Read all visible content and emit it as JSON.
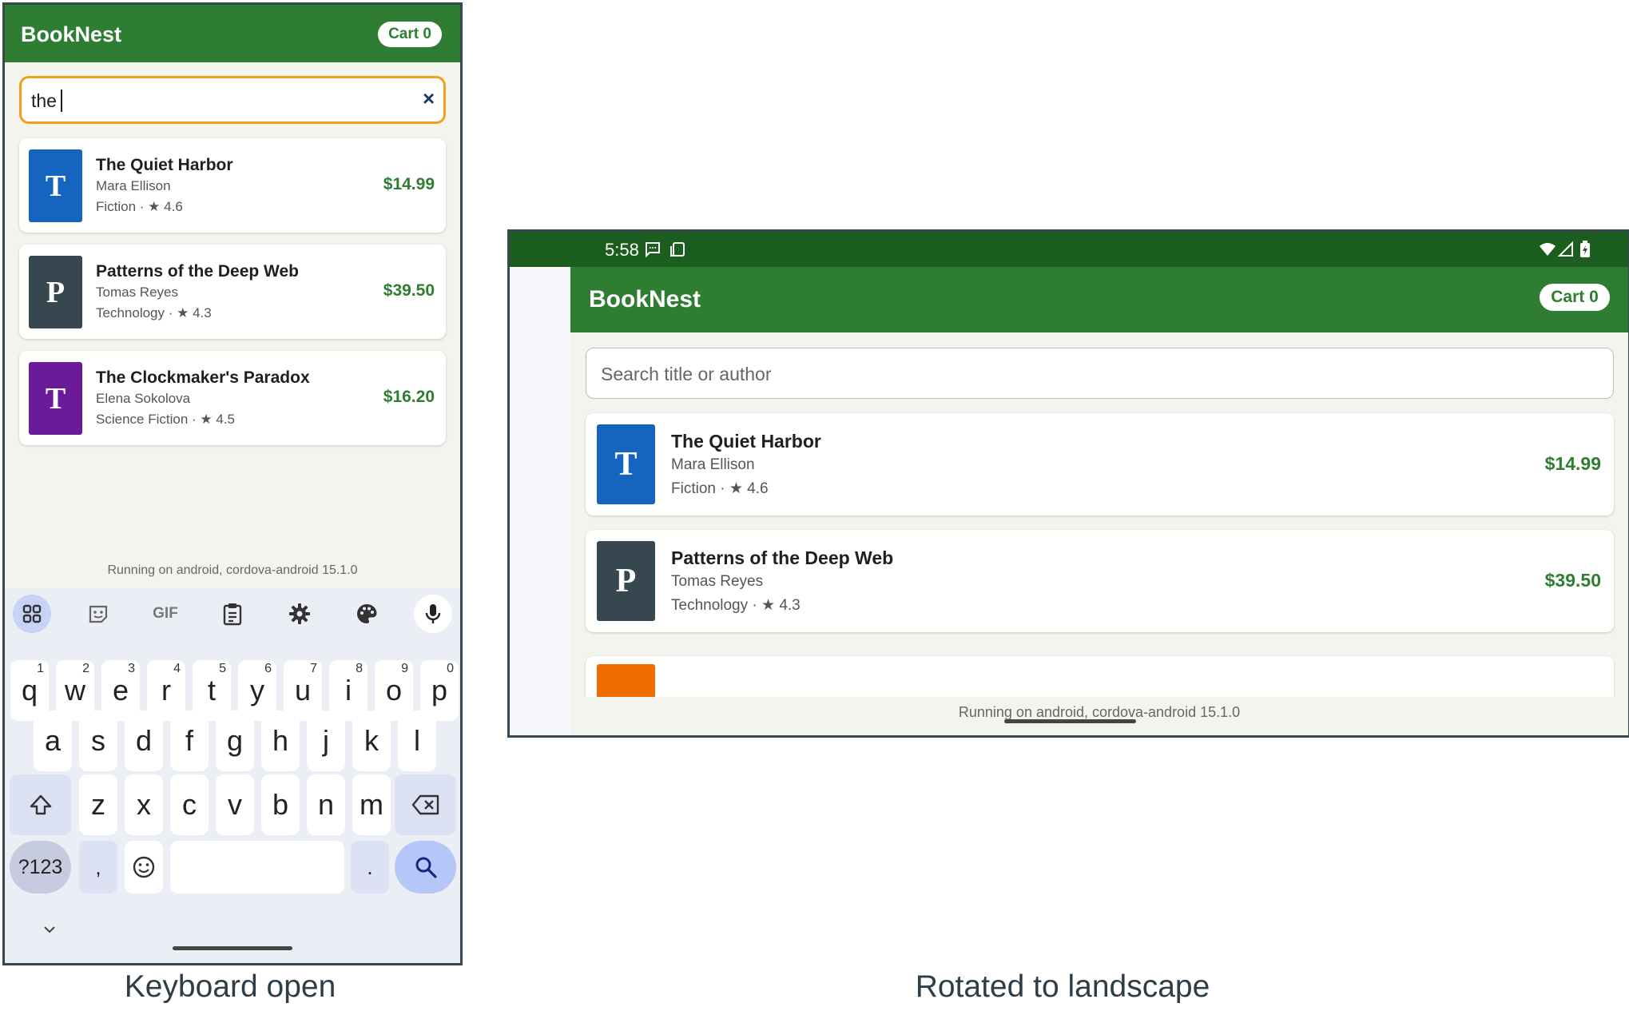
{
  "app": {
    "name": "BookNest",
    "cart_label": "Cart 0",
    "footer": "Running on android, cordova-android 15.1.0"
  },
  "portrait": {
    "search_value": "the",
    "clear_icon": "×",
    "books": [
      {
        "letter": "T",
        "title": "The Quiet Harbor",
        "author": "Mara Ellison",
        "meta": "Fiction · ★ 4.6",
        "price": "$14.99",
        "cover_color": "#1565c0"
      },
      {
        "letter": "P",
        "title": "Patterns of the Deep Web",
        "author": "Tomas Reyes",
        "meta": "Technology · ★ 4.3",
        "price": "$39.50",
        "cover_color": "#37474f"
      },
      {
        "letter": "T",
        "title": "The Clockmaker's Paradox",
        "author": "Elena Sokolova",
        "meta": "Science Fiction · ★ 4.5",
        "price": "$16.20",
        "cover_color": "#6a1b9a"
      }
    ],
    "caption": "Keyboard open"
  },
  "keyboard": {
    "toolbar_icons": [
      "apps-grid-icon",
      "sticker-icon",
      "gif-icon",
      "clipboard-icon",
      "settings-icon",
      "palette-icon",
      "microphone-icon"
    ],
    "gif_label": "GIF",
    "row1": [
      {
        "k": "q",
        "n": "1"
      },
      {
        "k": "w",
        "n": "2"
      },
      {
        "k": "e",
        "n": "3"
      },
      {
        "k": "r",
        "n": "4"
      },
      {
        "k": "t",
        "n": "5"
      },
      {
        "k": "y",
        "n": "6"
      },
      {
        "k": "u",
        "n": "7"
      },
      {
        "k": "i",
        "n": "8"
      },
      {
        "k": "o",
        "n": "9"
      },
      {
        "k": "p",
        "n": "0"
      }
    ],
    "row2": [
      "a",
      "s",
      "d",
      "f",
      "g",
      "h",
      "j",
      "k",
      "l"
    ],
    "row3": [
      "z",
      "x",
      "c",
      "v",
      "b",
      "n",
      "m"
    ],
    "symbols_label": "?123",
    "comma": ",",
    "period": ".",
    "collapse_icon": "chevron-down-icon"
  },
  "landscape": {
    "time": "5:58",
    "search_placeholder": "Search title or author",
    "books": [
      {
        "letter": "T",
        "title": "The Quiet Harbor",
        "author": "Mara Ellison",
        "meta": "Fiction · ★ 4.6",
        "price": "$14.99",
        "cover_color": "#1565c0"
      },
      {
        "letter": "P",
        "title": "Patterns of the Deep Web",
        "author": "Tomas Reyes",
        "meta": "Technology · ★ 4.3",
        "price": "$39.50",
        "cover_color": "#37474f"
      }
    ],
    "partial_cover_color": "#ef6c00",
    "caption": "Rotated to landscape"
  },
  "colors": {
    "primary": "#2e7d32",
    "status_bar": "#1b5e20",
    "search_focus_border": "#f0a020",
    "price": "#2e7d32"
  }
}
